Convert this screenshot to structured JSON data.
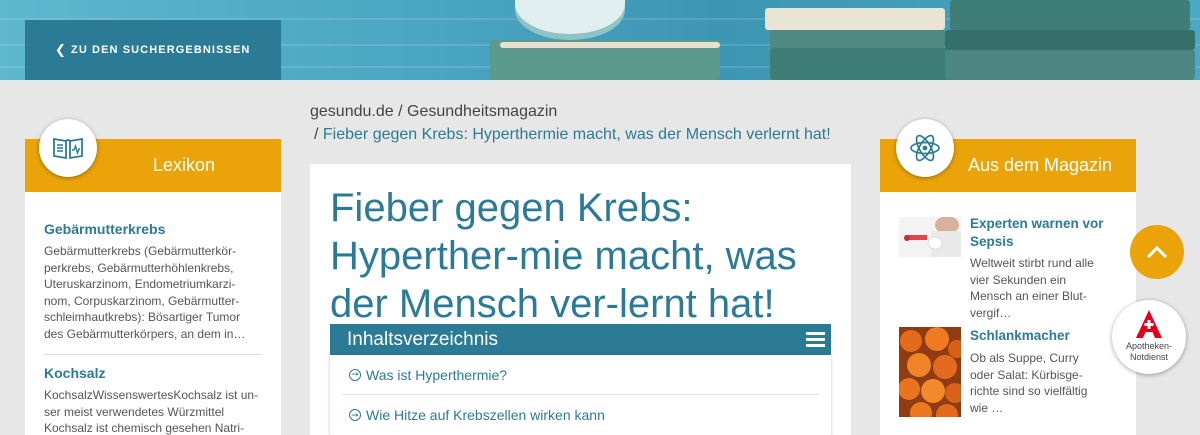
{
  "back_button": {
    "label": "ZU DEN SUCHERGEBNISSEN",
    "icon": "chevron-left-icon"
  },
  "breadcrumb": {
    "site": "gesundu.de",
    "separator": "/",
    "section": "Gesundheitsmagazin",
    "current": "Fieber gegen Krebs: Hyperthermie macht, was der Mensch verlernt hat!"
  },
  "lexikon": {
    "title": "Lexikon",
    "icon": "open-book-icon",
    "entries": [
      {
        "title": "Gebärmutterkrebs",
        "text": "Gebärmutterkrebs (Gebärmutterkör-perkrebs, Gebärmutterhöhlenkrebs, Uteruskarzinom, Endometriumkarzi-nom, Corpuskarzinom, Gebärmutter-schleimhautkrebs): Bösartiger Tumor des Gebärmutterkörpers, an dem in…"
      },
      {
        "title": "Kochsalz",
        "text": "KochsalzWissenswertesKochsalz ist un-ser meist verwendetes Würzmittel Kochsalz ist chemisch gesehen Natri-"
      }
    ]
  },
  "article": {
    "title": "Fieber gegen Krebs: Hyperther-mie macht, was der Mensch ver-lernt hat!",
    "toc": {
      "title": "Inhaltsverzeichnis",
      "items": [
        "Was ist Hyperthermie?",
        "Wie Hitze auf Krebszellen wirken kann"
      ]
    }
  },
  "magazin": {
    "title": "Aus dem Magazin",
    "icon": "atom-icon",
    "items": [
      {
        "title": "Experten warnen vor Sepsis",
        "text": "Weltweit stirbt rund alle vier Sekunden ein Mensch an einer Blut-vergif…"
      },
      {
        "title": "Schlankmacher",
        "text": "Ob als Suppe, Curry oder Salat: Kürbisge-richte sind so vielfältig wie …"
      }
    ]
  },
  "floating": {
    "scroll_top_icon": "chevron-up-icon",
    "apotheke_label": "Apotheken-Notdienst",
    "apotheke_icon": "pharmacy-logo-icon"
  },
  "colors": {
    "teal": "#2b7b96",
    "orange": "#eaa309",
    "background": "#e7e7e7",
    "pharmacy_red": "#e2001a"
  }
}
